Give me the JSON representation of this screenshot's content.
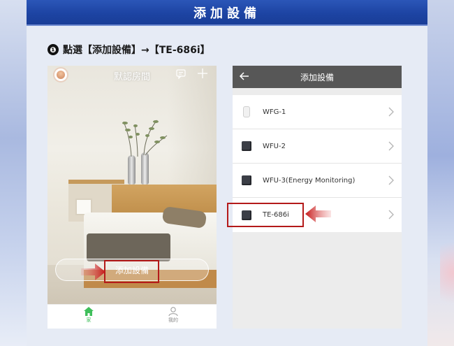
{
  "header": {
    "title": "添加設備"
  },
  "step": {
    "number": "❶",
    "text": "點選【添加設備】→【TE-686i】"
  },
  "left_phone": {
    "room_title": "默認房間",
    "add_device_label": "添加設備",
    "tabs": [
      {
        "label": "家",
        "icon": "home-icon",
        "active": true
      },
      {
        "label": "我的",
        "icon": "user-icon",
        "active": false
      }
    ]
  },
  "right_phone": {
    "title": "添加設備",
    "devices": [
      {
        "name": "WFG-1",
        "icon": "white-plug-icon"
      },
      {
        "name": "WFU-2",
        "icon": "dark-plug-icon"
      },
      {
        "name": "WFU-3(Energy Monitoring)",
        "icon": "dark-plug-icon"
      },
      {
        "name": "TE-686i",
        "icon": "dark-plug-icon",
        "highlighted": true
      }
    ]
  },
  "colors": {
    "header_blue": "#1d44a3",
    "highlight_red": "#b41a1a",
    "active_tab_green": "#3fbf5b",
    "right_bar_gray": "#575757"
  }
}
